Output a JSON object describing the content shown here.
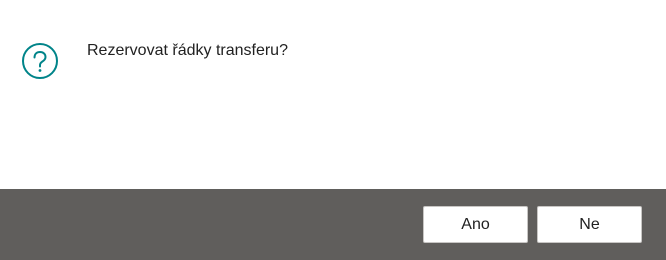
{
  "dialog": {
    "icon": "question-circle-icon",
    "icon_color": "#008489",
    "message": "Rezervovat řádky transferu?"
  },
  "buttons": {
    "yes_label": "Ano",
    "no_label": "Ne"
  },
  "colors": {
    "footer_background": "#605e5c",
    "button_background": "#ffffff",
    "text": "#212121"
  }
}
